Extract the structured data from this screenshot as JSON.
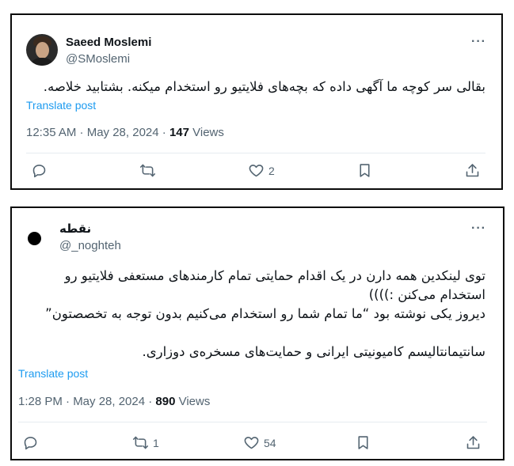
{
  "tweets": [
    {
      "display_name": "Saeed Moslemi",
      "handle": "@SMoslemi",
      "text": "بقالی سر کوچه ما آگهی داده که بچه‌های فلایتیو رو استخدام میکنه. بشتابید خلاصه.",
      "translate": "Translate post",
      "time": "12:35 AM · May 28, 2024 · ",
      "views": "147",
      "views_label": " Views",
      "actions": {
        "reply_count": "",
        "retweet_count": "",
        "like_count": "2"
      }
    },
    {
      "display_name": "نقطه",
      "handle": "@_noghteh",
      "text_lines": [
        "توی لینکدین همه دارن در یک اقدام حمایتی تمام کارمندهای مستعفی فلایتیو رو",
        "استخدام می‌کنن :))))",
        "دیروز یکی نوشته بود “ما تمام شما رو استخدام می‌کنیم بدون توجه به تخصصتون”",
        "",
        "سانتیمانتالیسم کامیونیتی ایرانی و حمایت‌های مسخره‌ی دوزاری."
      ],
      "translate": "Translate post",
      "time": "1:28 PM · May 28, 2024 · ",
      "views": "890",
      "views_label": " Views",
      "actions": {
        "reply_count": "",
        "retweet_count": "1",
        "like_count": "54"
      }
    }
  ]
}
